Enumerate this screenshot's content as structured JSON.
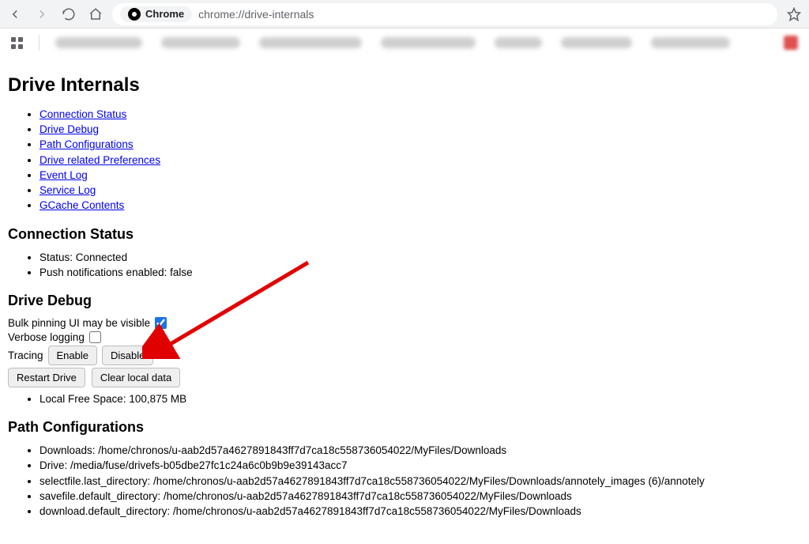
{
  "browser": {
    "site_label": "Chrome",
    "url": "chrome://drive-internals"
  },
  "page": {
    "title": "Drive Internals"
  },
  "nav_links": [
    "Connection Status",
    "Drive Debug",
    "Path Configurations",
    "Drive related Preferences",
    "Event Log",
    "Service Log",
    "GCache Contents"
  ],
  "connection_status": {
    "heading": "Connection Status",
    "items": [
      "Status: Connected",
      "Push notifications enabled: false"
    ]
  },
  "drive_debug": {
    "heading": "Drive Debug",
    "bulk_pinning_label": "Bulk pinning UI may be visible",
    "bulk_pinning_checked": true,
    "verbose_logging_label": "Verbose logging",
    "verbose_logging_checked": false,
    "tracing_label": "Tracing",
    "enable_label": "Enable",
    "disable_label": "Disable",
    "restart_label": "Restart Drive",
    "clear_label": "Clear local data",
    "free_space_item": "Local Free Space: 100,875 MB"
  },
  "path_config": {
    "heading": "Path Configurations",
    "items": [
      "Downloads: /home/chronos/u-aab2d57a4627891843ff7d7ca18c558736054022/MyFiles/Downloads",
      "Drive: /media/fuse/drivefs-b05dbe27fc1c24a6c0b9b9e39143acc7",
      "selectfile.last_directory: /home/chronos/u-aab2d57a4627891843ff7d7ca18c558736054022/MyFiles/Downloads/annotely_images (6)/annotely",
      "savefile.default_directory: /home/chronos/u-aab2d57a4627891843ff7d7ca18c558736054022/MyFiles/Downloads",
      "download.default_directory: /home/chronos/u-aab2d57a4627891843ff7d7ca18c558736054022/MyFiles/Downloads"
    ]
  },
  "annotation": {
    "arrow_color": "#e10000"
  }
}
